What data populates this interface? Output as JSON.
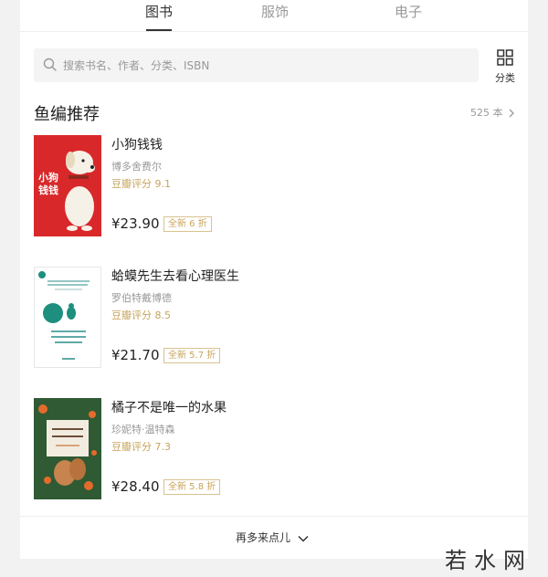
{
  "tabs": [
    {
      "label": "图书"
    },
    {
      "label": "服饰"
    },
    {
      "label": "电子"
    }
  ],
  "search": {
    "placeholder": "搜索书名、作者、分类、ISBN",
    "icon": "search-icon"
  },
  "category": {
    "label": "分类",
    "icon": "grid-icon"
  },
  "section": {
    "title": "鱼编推荐",
    "count": "525 本"
  },
  "books": [
    {
      "title": "小狗钱钱",
      "author": "博多舍费尔",
      "rating": "豆瓣评分 9.1",
      "price": "¥23.90",
      "badge": "全新 6 折",
      "cover_title": "小狗钱钱"
    },
    {
      "title": "蛤蟆先生去看心理医生",
      "author": "罗伯特戴博德",
      "rating": "豆瓣评分 8.5",
      "price": "¥21.70",
      "badge": "全新 5.7 折",
      "cover_title": "蛤蟆先生去看心理医生"
    },
    {
      "title": "橘子不是唯一的水果",
      "author": "珍妮特·温特森",
      "rating": "豆瓣评分 7.3",
      "price": "¥28.40",
      "badge": "全新 5.8 折",
      "cover_title": "橘子不是唯一的水果"
    }
  ],
  "more": {
    "label": "再多来点儿"
  },
  "watermark": "若水网",
  "colors": {
    "accent": "#c7a35a",
    "background": "#f2f2f2",
    "panel": "#ffffff",
    "cover1": "#d9282a",
    "cover3": "#2f5a33"
  }
}
